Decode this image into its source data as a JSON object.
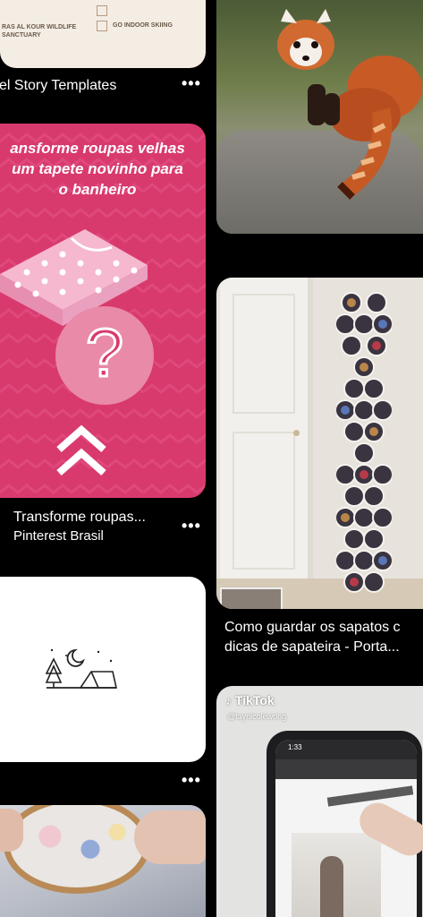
{
  "feed": {
    "left": [
      {
        "checklist_left": [
          "RAS AL KOUR WILDLIFE",
          "SANCTUARY"
        ],
        "checklist_right": "GO INDOOR SKIING",
        "title": "el Story Templates",
        "more": "•••"
      },
      {
        "overlay_lines": [
          "ansforme roupas velhas",
          "um tapete novinho para",
          "o banheiro"
        ],
        "question": "?",
        "title": "Transforme roupas...",
        "subtitle": "Pinterest Brasil",
        "more": "•••"
      },
      {
        "icon": "camping-night-icon",
        "more": "•••"
      },
      {
        "icon": "embroidery-hoop-photo"
      }
    ],
    "right": [
      {
        "image": "red-panda-photo"
      },
      {
        "image": "shoe-organizer-photo",
        "title_lines": [
          "Como guardar os sapatos c",
          "dicas de sapateira - Porta..."
        ]
      },
      {
        "watermark": "TikTok",
        "handle": "@taynicolewong",
        "phone_time": "1:33"
      }
    ]
  },
  "colors": {
    "pink": "#d93a6e",
    "pink_dark": "#c92e60",
    "background": "#000000"
  }
}
